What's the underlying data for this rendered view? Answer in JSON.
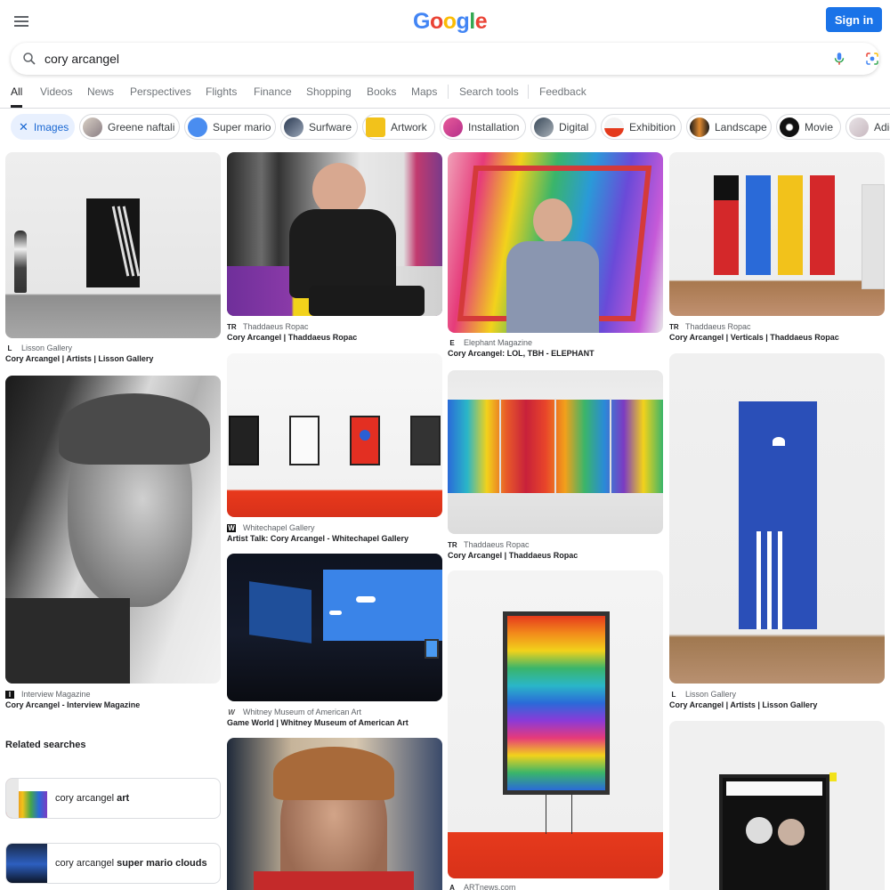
{
  "header": {
    "logo": [
      "G",
      "o",
      "o",
      "g",
      "l",
      "e"
    ],
    "sign_in": "Sign in"
  },
  "search": {
    "query": "cory arcangel"
  },
  "tabs": [
    "All",
    "Videos",
    "News",
    "Perspectives",
    "Flights",
    "Finance",
    "Shopping",
    "Books",
    "Maps"
  ],
  "tools": {
    "search_tools": "Search tools",
    "feedback": "Feedback"
  },
  "chips": {
    "active": "Images",
    "items": [
      "Greene naftali",
      "Super mario",
      "Surfware",
      "Artwork",
      "Installation",
      "Digital",
      "Exhibition",
      "Landscape",
      "Movie",
      "Adid"
    ]
  },
  "results": [
    {
      "source": "Lisson Gallery",
      "title": "Cory Arcangel | Artists | Lisson Gallery",
      "favicon": "L"
    },
    {
      "source": "Thaddaeus Ropac",
      "title": "Cory Arcangel | Thaddaeus Ropac",
      "favicon": "TR"
    },
    {
      "source": "Elephant Magazine",
      "title": "Cory Arcangel: LOL, TBH - ELEPHANT",
      "favicon": "E"
    },
    {
      "source": "Thaddaeus Ropac",
      "title": "Cory Arcangel | Verticals | Thaddaeus Ropac",
      "favicon": "TR"
    },
    {
      "source": "Whitechapel Gallery",
      "title": "Artist Talk: Cory Arcangel - Whitechapel Gallery",
      "favicon": "W"
    },
    {
      "source": "Thaddaeus Ropac",
      "title": "Cory Arcangel | Thaddaeus Ropac",
      "favicon": "TR"
    },
    {
      "source": "Interview Magazine",
      "title": "Cory Arcangel - Interview Magazine",
      "favicon": "I"
    },
    {
      "source": "Whitney Museum of American Art",
      "title": "Game World | Whitney Museum of American Art",
      "favicon": "W"
    },
    {
      "source": "Lisson Gallery",
      "title": "Cory Arcangel | Artists | Lisson Gallery",
      "favicon": "L"
    },
    {
      "source": "ARTnews.com",
      "title": "",
      "favicon": "A"
    }
  ],
  "related": {
    "heading": "Related searches",
    "items": [
      {
        "prefix": "cory arcangel ",
        "bold": "art"
      },
      {
        "prefix": "cory arcangel ",
        "bold": "super mario clouds"
      }
    ]
  },
  "colors": {
    "accent": "#1a73e8",
    "chip_active_bg": "#e8f0fe"
  }
}
